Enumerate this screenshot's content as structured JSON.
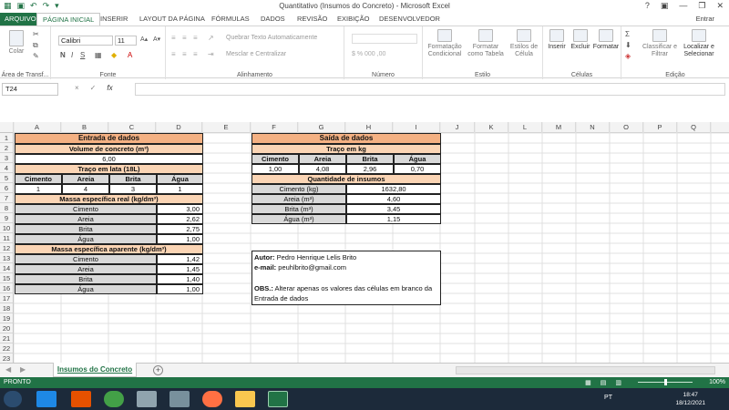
{
  "window": {
    "title": "Quantitativo (Insumos do Concreto) - Microsoft Excel",
    "help": "?",
    "user": "Entrar"
  },
  "tabs": [
    "ARQUIVO",
    "PÁGINA INICIAL",
    "INSERIR",
    "LAYOUT DA PÁGINA",
    "FÓRMULAS",
    "DADOS",
    "REVISÃO",
    "EXIBIÇÃO",
    "DESENVOLVEDOR"
  ],
  "ribbon": {
    "paste": "Colar",
    "clipboard_group": "Área de Transf...",
    "font_name": "Calibri",
    "font_size": "11",
    "font_group": "Fonte",
    "wrap_text": "Quebrar Texto Automaticamente",
    "merge_center": "Mesclar e Centralizar",
    "alignment_group": "Alinhamento",
    "number_group": "Número",
    "cond_format": "Formatação Condicional",
    "format_table": "Formatar como Tabela",
    "cell_styles": "Estilos de Célula",
    "styles_group": "Estilo",
    "insert": "Inserir",
    "delete": "Excluir",
    "format": "Formatar",
    "cells_group": "Células",
    "sort_filter": "Classificar e Filtrar",
    "find_select": "Localizar e Selecionar",
    "editing_group": "Edição"
  },
  "formula_bar": {
    "name_box": "T24",
    "fx": "fx",
    "cancel": "×",
    "enter": "✓"
  },
  "columns": [
    "A",
    "B",
    "C",
    "D",
    "E",
    "F",
    "G",
    "H",
    "I",
    "J",
    "K",
    "L",
    "M",
    "N",
    "O",
    "P",
    "Q"
  ],
  "rows": [
    "1",
    "2",
    "3",
    "4",
    "5",
    "6",
    "7",
    "8",
    "9",
    "10",
    "11",
    "12",
    "13",
    "14",
    "15",
    "16",
    "17",
    "18",
    "19",
    "20",
    "21",
    "22",
    "23"
  ],
  "entrada": {
    "title": "Entrada de dados",
    "volume_label": "Volume de concreto (m³)",
    "volume_value": "6,00",
    "traco_label": "Traço em lata (18L)",
    "headers": [
      "Cimento",
      "Areia",
      "Brita",
      "Água"
    ],
    "traco_values": [
      "1",
      "4",
      "3",
      "1"
    ],
    "massa_real_label": "Massa específica real (kg/dm³)",
    "massa_real": [
      {
        "name": "Cimento",
        "value": "3,00"
      },
      {
        "name": "Areia",
        "value": "2,62"
      },
      {
        "name": "Brita",
        "value": "2,75"
      },
      {
        "name": "Água",
        "value": "1,00"
      }
    ],
    "massa_aparente_label": "Massa específica aparente (kg/dm³)",
    "massa_aparente": [
      {
        "name": "Cimento",
        "value": "1,42"
      },
      {
        "name": "Areia",
        "value": "1,45"
      },
      {
        "name": "Brita",
        "value": "1,40"
      },
      {
        "name": "Água",
        "value": "1,00"
      }
    ]
  },
  "saida": {
    "title": "Saída de dados",
    "traco_kg_label": "Traço em kg",
    "headers": [
      "Cimento",
      "Areia",
      "Brita",
      "Água"
    ],
    "traco_kg_values": [
      "1,00",
      "4,08",
      "2,96",
      "0,70"
    ],
    "quantidade_label": "Quantidade de insumos",
    "quantidades": [
      {
        "name": "Cimento (kg)",
        "value": "1632,80"
      },
      {
        "name": "Areia (m³)",
        "value": "4,60"
      },
      {
        "name": "Brita (m³)",
        "value": "3,45"
      },
      {
        "name": "Água (m³)",
        "value": "1,15"
      }
    ]
  },
  "notes": {
    "autor_label": "Autor:",
    "autor": "Pedro Henrique Lelis Brito",
    "email_label": "e-mail:",
    "email": "peuhlbrito@gmail.com",
    "obs_label": "OBS.:",
    "obs_line1": "Alterar apenas os valores das células em branco da",
    "obs_line2": "Entrada de dados"
  },
  "sheet": {
    "tab": "Insumos do Concreto",
    "add": "+"
  },
  "status": {
    "ready": "PRONTO",
    "zoom": "100%"
  },
  "taskbar": {
    "lang": "PT",
    "time": "18:47",
    "date": "18/12/2021"
  },
  "colors": {
    "excel_green": "#217346",
    "header_orange": "#f4b183",
    "sub_orange": "#fbd5b5",
    "gray_cell": "#d9d9d9"
  }
}
